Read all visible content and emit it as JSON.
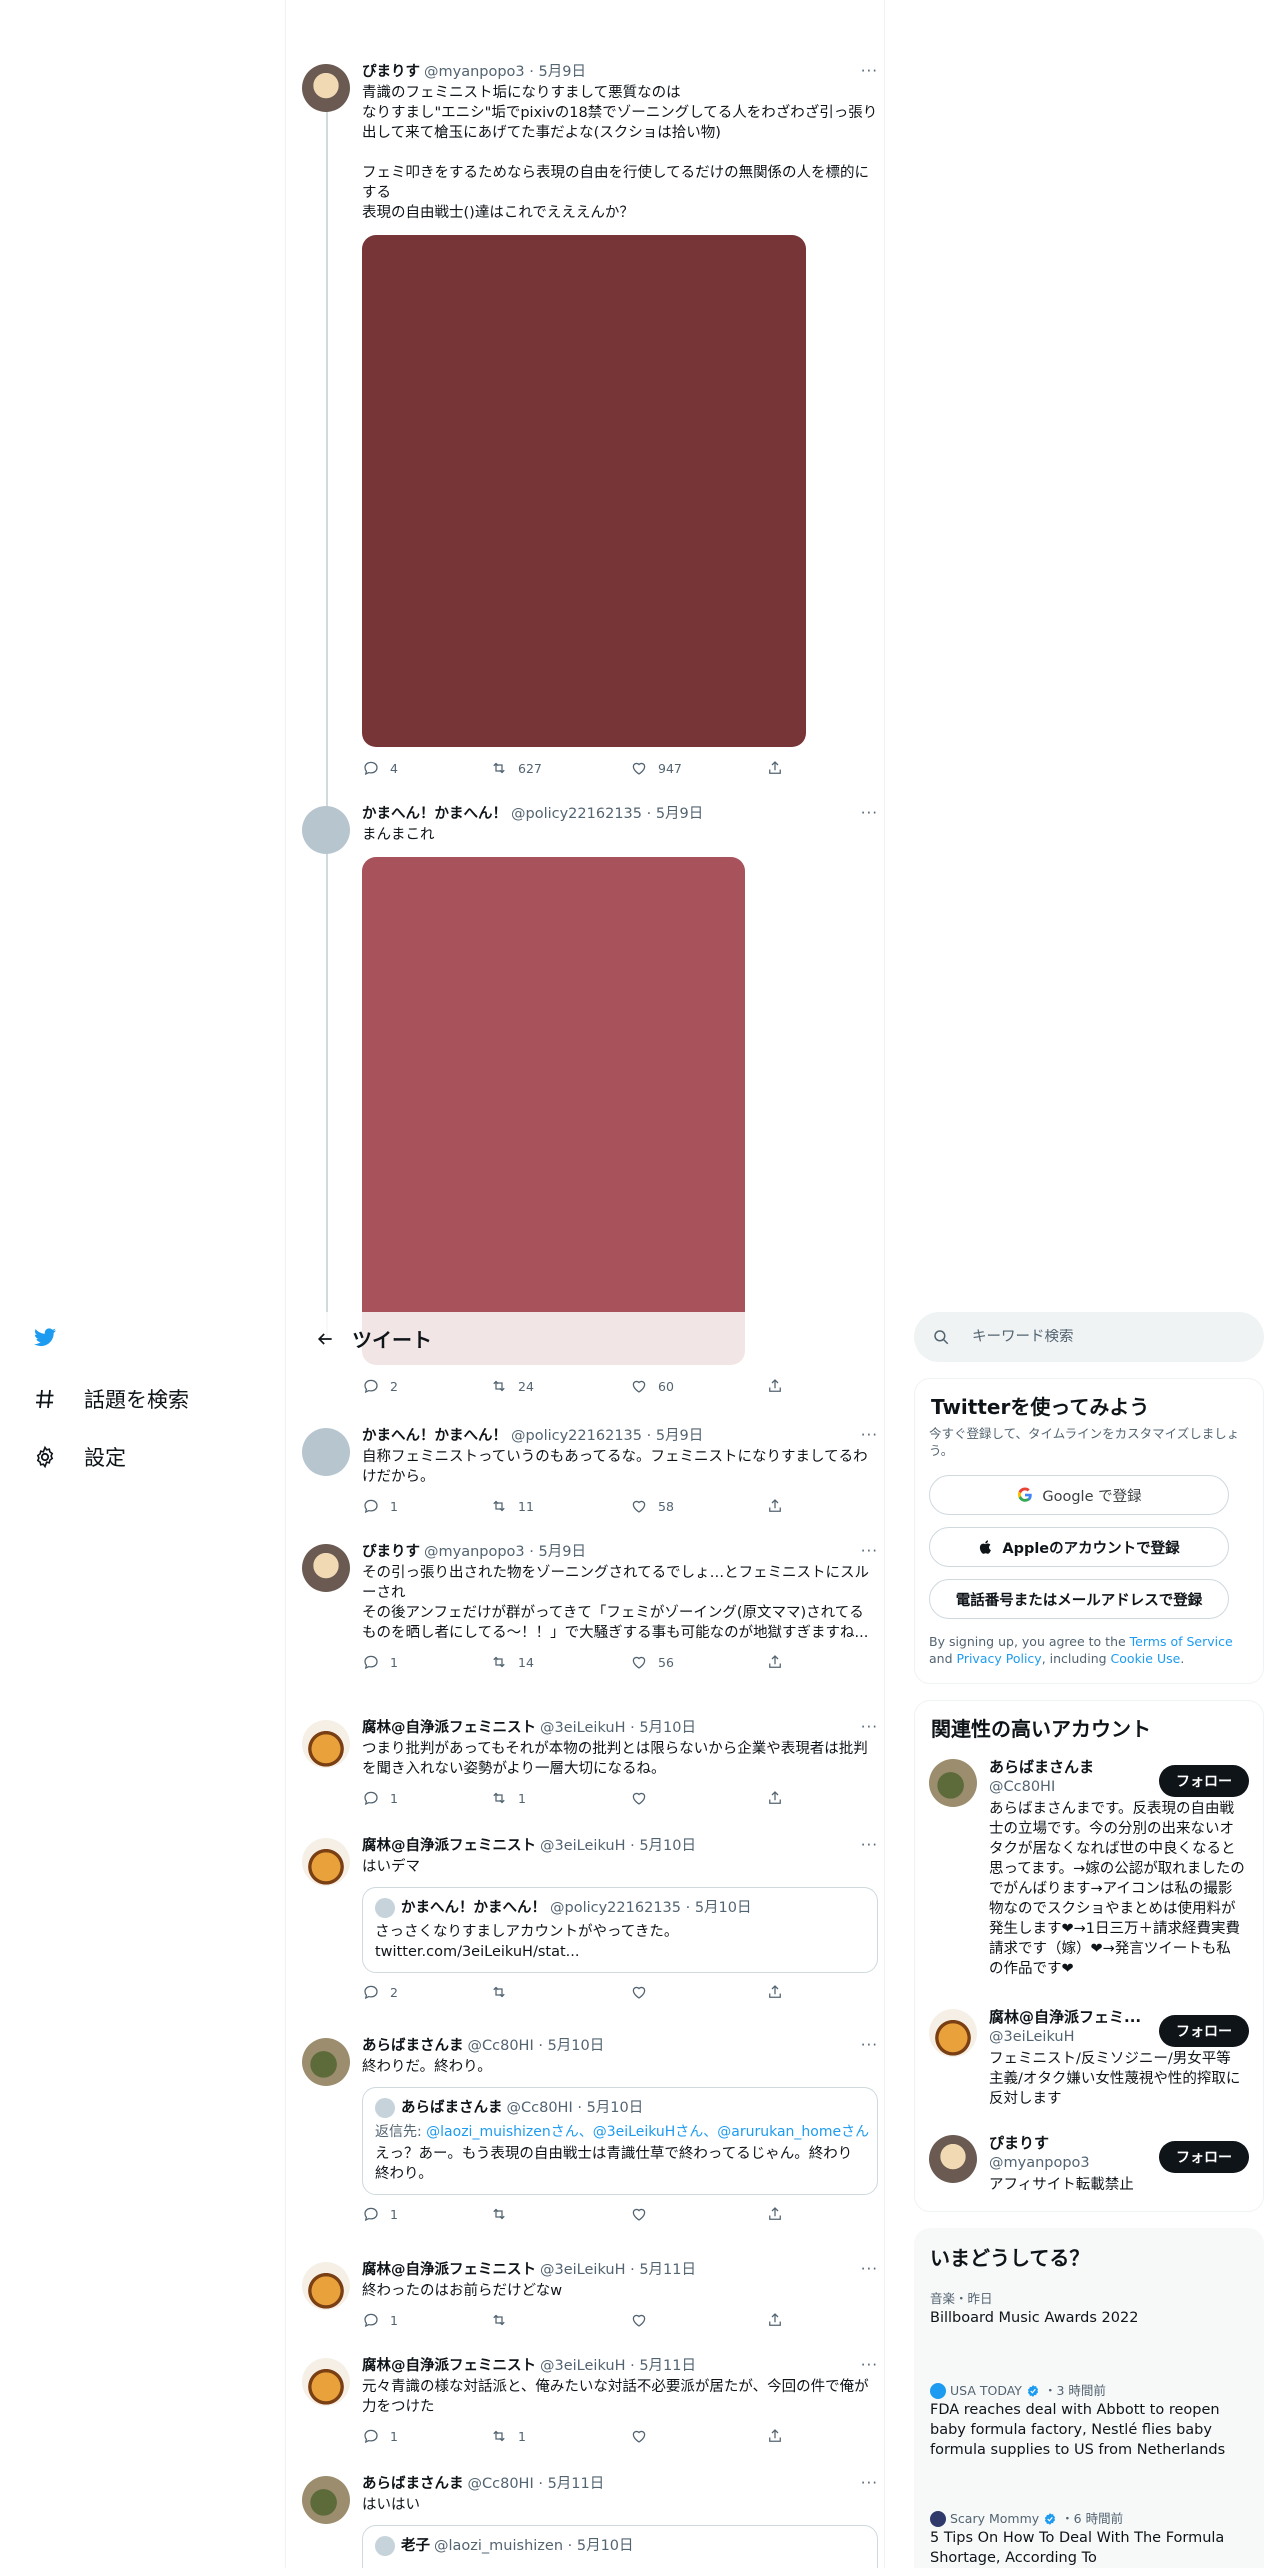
{
  "nav": {
    "explore_label": "話題を検索",
    "settings_label": "設定"
  },
  "header": {
    "title": "ツイート"
  },
  "search": {
    "placeholder": "キーワード検索"
  },
  "tweets": [
    {
      "name": "ぴまりす",
      "handle": "@myanpopo3",
      "date": "5月9日",
      "text": "青識のフェミニスト垢になりすまして悪質なのは\nなりすまし\"エニシ\"垢でpixivの18禁でゾーニングしてる人をわざわざ引っ張り出して来て槍玉にあげてた事だよな(スクショは拾い物)\n\nフェミ叩きをするためなら表現の自由を行使してるだけの無関係の人を標的にする\n表現の自由戦士()達はこれでえええんか？",
      "replies": "4",
      "retweets": "627",
      "likes": "947",
      "media_color": "#773538"
    },
    {
      "name": "かまへん！かまへん！",
      "handle": "@policy22162135",
      "date": "5月9日",
      "text": "まんまこれ",
      "replies": "2",
      "retweets": "24",
      "likes": "60",
      "media_color": "#a8525b"
    },
    {
      "name": "かまへん！かまへん！",
      "handle": "@policy22162135",
      "date": "5月9日",
      "text": "自称フェミニストっていうのもあってるな。フェミニストになりすましてるわけだから。",
      "replies": "1",
      "retweets": "11",
      "likes": "58"
    },
    {
      "name": "ぴまりす",
      "handle": "@myanpopo3",
      "date": "5月9日",
      "text": "その引っ張り出された物をゾーニングされてるでしょ…とフェミニストにスルーされ\nその後アンフェだけが群がってきて「フェミがゾーイング(原文ママ)されてるものを晒し者にしてる〜！！」で大騒ぎする事も可能なのが地獄すぎますね...",
      "replies": "1",
      "retweets": "14",
      "likes": "56"
    },
    {
      "name": "腐林@自浄派フェミニスト",
      "handle": "@3eiLeikuH",
      "date": "5月10日",
      "text": "つまり批判があってもそれが本物の批判とは限らないから企業や表現者は批判を聞き入れない姿勢がより一層大切になるね。",
      "replies": "1",
      "retweets": "1",
      "likes": ""
    },
    {
      "name": "腐林@自浄派フェミニスト",
      "handle": "@3eiLeikuH",
      "date": "5月10日",
      "text": "はいデマ",
      "replies": "2",
      "retweets": "",
      "likes": "",
      "quote": {
        "name": "かまへん！かまへん！",
        "handle": "@policy22162135",
        "date": "5月10日",
        "text": "さっさくなりすましアカウントがやってきた。\ntwitter.com/3eiLeikuH/stat..."
      }
    },
    {
      "name": "あらばまさんま",
      "handle": "@Cc80HI",
      "date": "5月10日",
      "text": "終わりだ。終わり。",
      "replies": "1",
      "retweets": "",
      "likes": "",
      "quote": {
        "name": "あらばまさんま",
        "handle": "@Cc80HI",
        "date": "5月10日",
        "reply_prefix": "返信先: ",
        "reply_to": "@laozi_muishizenさん、@3eiLeikuHさん、@arurukan_homeさん",
        "text": "えっ？あー。もう表現の自由戦士は青識仕草で終わってるじゃん。終わり終わり。"
      }
    },
    {
      "name": "腐林@自浄派フェミニスト",
      "handle": "@3eiLeikuH",
      "date": "5月11日",
      "text": "終わったのはお前らだけどなw",
      "replies": "1",
      "retweets": "",
      "likes": ""
    },
    {
      "name": "腐林@自浄派フェミニスト",
      "handle": "@3eiLeikuH",
      "date": "5月11日",
      "text": "元々青識の様な対話派と、俺みたいな対話不必要派が居たが、今回の件で俺が力をつけた",
      "replies": "1",
      "retweets": "1",
      "likes": ""
    },
    {
      "name": "あらばまさんま",
      "handle": "@Cc80HI",
      "date": "5月11日",
      "text": "はいはい",
      "quote": {
        "name": "老子",
        "handle": "@laozi_muishizen",
        "date": "5月10日"
      }
    }
  ],
  "signup": {
    "title": "Twitterを使ってみよう",
    "subtitle": "今すぐ登録して、タイムラインをカスタマイズしましょう。",
    "google_label": "Google で登録",
    "apple_label": "Appleのアカウントで登録",
    "phone_label": "電話番号またはメールアドレスで登録",
    "terms_prefix": "By signing up, you agree to the ",
    "terms_link": "Terms of Service",
    "terms_and": " and ",
    "privacy_link": "Privacy Policy",
    "terms_including": ", including ",
    "cookie_link": "Cookie Use",
    "terms_end": "."
  },
  "related": {
    "title": "関連性の高いアカウント",
    "follow_label": "フォロー",
    "accounts": [
      {
        "name": "あらばまさんま",
        "handle": "@Cc80HI",
        "bio": "あらばまさんまです。反表現の自由戦士の立場です。今の分別の出来ないオタクが居なくなれば世の中良くなると思ってます。→嫁の公認が取れましたのでがんばります→アイコンは私の撮影物なのでスクショやまとめは使用料が発生します❤→1日三万＋請求経費実費請求です（嫁）❤→発言ツイートも私の作品です❤"
      },
      {
        "name": "腐林@自浄派フェミ...",
        "handle": "@3eiLeikuH",
        "bio": "フェミニスト/反ミソジニー/男女平等主義/オタク嫌い女性蔑視や性的搾取に反対します"
      },
      {
        "name": "ぴまりす",
        "handle": "@myanpopo3",
        "bio": "アフィサイト転載禁止"
      }
    ]
  },
  "trends": {
    "title": "いまどうしてる？",
    "items": [
      {
        "meta": "音楽・昨日",
        "title": "Billboard Music Awards 2022"
      },
      {
        "source": "USA TODAY",
        "time": "・3 時間前",
        "title": "FDA reaches deal with Abbott to reopen baby formula factory, Nestlé flies baby formula supplies to US from Netherlands"
      },
      {
        "source": "Scary Mommy",
        "time": "・6 時間前",
        "title": "5 Tips On How To Deal With The Formula Shortage, According To"
      }
    ]
  },
  "colors": {
    "accent": "#1d9bf0",
    "text": "#0f1419",
    "secondary": "#536471"
  }
}
